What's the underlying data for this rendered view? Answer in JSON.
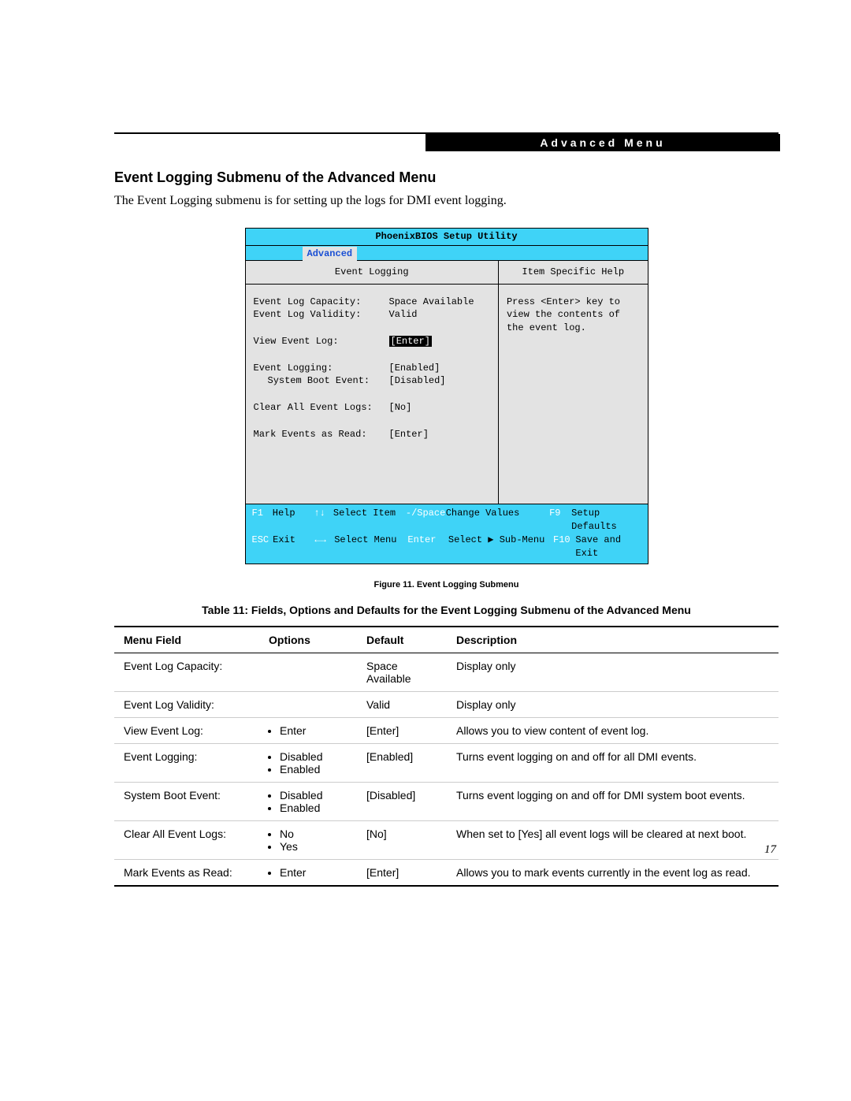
{
  "header_badge": "Advanced Menu",
  "section_title": "Event Logging Submenu of the Advanced Menu",
  "intro": "The Event Logging submenu is for setting up the logs for DMI event logging.",
  "bios": {
    "title": "PhoenixBIOS Setup Utility",
    "active_tab": "Advanced",
    "left_title": "Event Logging",
    "right_title": "Item Specific Help",
    "help_text": "Press <Enter> key to view the contents of the event log.",
    "rows": [
      {
        "label": "Event Log Capacity:",
        "value": "Space Available",
        "indent": false,
        "hi": false
      },
      {
        "label": "Event Log Validity:",
        "value": "Valid",
        "indent": false,
        "hi": false
      },
      {
        "label": "",
        "value": "",
        "indent": false,
        "hi": false
      },
      {
        "label": "View Event Log:",
        "value": "[Enter]",
        "indent": false,
        "hi": true
      },
      {
        "label": "",
        "value": "",
        "indent": false,
        "hi": false
      },
      {
        "label": "Event Logging:",
        "value": "[Enabled]",
        "indent": false,
        "hi": false
      },
      {
        "label": "System Boot Event:",
        "value": "[Disabled]",
        "indent": true,
        "hi": false
      },
      {
        "label": "",
        "value": "",
        "indent": false,
        "hi": false
      },
      {
        "label": "Clear All Event Logs:",
        "value": "[No]",
        "indent": false,
        "hi": false
      },
      {
        "label": "",
        "value": "",
        "indent": false,
        "hi": false
      },
      {
        "label": "Mark Events as Read:",
        "value": "[Enter]",
        "indent": false,
        "hi": false
      }
    ],
    "footer": {
      "r1": {
        "k1": "F1",
        "t1": "Help",
        "k2": "↑↓",
        "t2": "Select Item",
        "k3": "-/Space",
        "t3": "Change Values",
        "k4": "F9",
        "t4": "Setup Defaults"
      },
      "r2": {
        "k1": "ESC",
        "t1": "Exit",
        "k2": "←→",
        "t2": "Select Menu",
        "k3": "Enter",
        "t3": "Select ▶ Sub-Menu",
        "k4": "F10",
        "t4": "Save and Exit"
      }
    }
  },
  "figure_caption": "Figure 11.  Event Logging Submenu",
  "table_caption": "Table 11: Fields, Options and Defaults for the Event Logging Submenu of the Advanced Menu",
  "table": {
    "headers": {
      "menu": "Menu Field",
      "options": "Options",
      "default": "Default",
      "desc": "Description"
    },
    "rows": [
      {
        "menu": "Event Log Capacity:",
        "options": [],
        "default": "Space Available",
        "desc": "Display only"
      },
      {
        "menu": "Event Log Validity:",
        "options": [],
        "default": "Valid",
        "desc": "Display only"
      },
      {
        "menu": "View Event Log:",
        "options": [
          "Enter"
        ],
        "default": "[Enter]",
        "desc": "Allows you to view content of event log."
      },
      {
        "menu": "Event Logging:",
        "options": [
          "Disabled",
          "Enabled"
        ],
        "default": "[Enabled]",
        "desc": "Turns event logging on and off for all DMI events."
      },
      {
        "menu": "System Boot Event:",
        "options": [
          "Disabled",
          "Enabled"
        ],
        "default": "[Disabled]",
        "desc": "Turns event logging on and off for DMI system boot events."
      },
      {
        "menu": "Clear All Event Logs:",
        "options": [
          "No",
          "Yes"
        ],
        "default": "[No]",
        "desc": "When set to [Yes] all event logs will be cleared at next boot."
      },
      {
        "menu": "Mark Events as Read:",
        "options": [
          "Enter"
        ],
        "default": "[Enter]",
        "desc": "Allows you to mark events currently in the event log as read."
      }
    ]
  },
  "page_number": "17"
}
